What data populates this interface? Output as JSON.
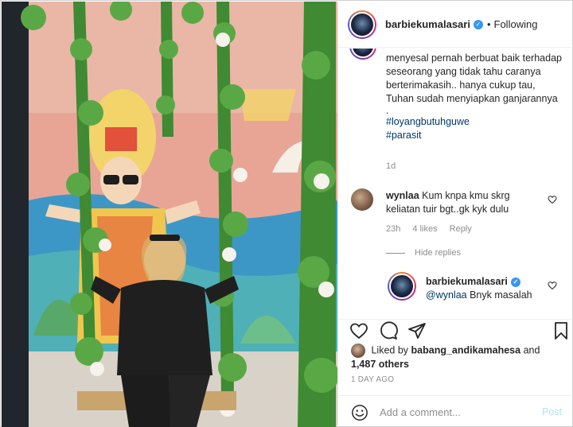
{
  "header": {
    "username": "barbiekumalasari",
    "verified_glyph": "✓",
    "separator": "•",
    "follow_status": "Following"
  },
  "caption": {
    "text": "menyesal pernah berbuat baik terhadap seseorang yang tidak tahu caranya berterimakasih.. hanya cukup tau, Tuhan sudah menyiapkan ganjarannya",
    "dot": ".",
    "hashtags": [
      "#loyangbutuhguwe",
      "#parasit"
    ],
    "time": "1d"
  },
  "comment": {
    "username": "wynlaa",
    "text": "Kum knpa kmu skrg keliatan tuir bgt..gk kyk dulu",
    "time": "23h",
    "likes": "4 likes",
    "reply_label": "Reply",
    "hide_replies": "Hide replies"
  },
  "reply": {
    "username": "barbiekumalasari",
    "mention": "@wynlaa",
    "text": "Bnyk masalah"
  },
  "likes": {
    "prefix": "Liked by",
    "user": "babang_andikamahesa",
    "and": "and",
    "others": "1,487 others"
  },
  "posted": "1 DAY AGO",
  "add_comment": {
    "placeholder": "Add a comment...",
    "post_label": "Post"
  },
  "icons": {
    "like": "heart-icon",
    "comment": "comment-icon",
    "share": "paper-plane-icon",
    "save": "bookmark-icon",
    "emoji": "smiley-icon"
  },
  "colors": {
    "link": "#00376b",
    "meta": "#8e8e8e",
    "verified": "#3897f0",
    "post_disabled": "#b2dffc"
  }
}
